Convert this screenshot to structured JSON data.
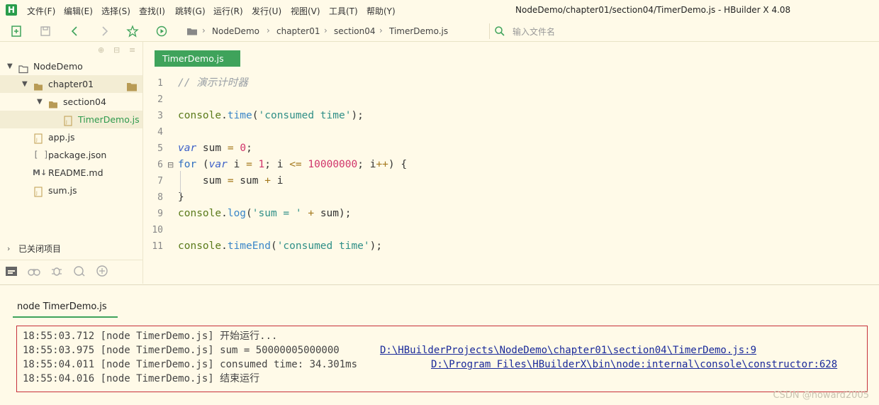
{
  "app": {
    "logo_letter": "H",
    "window_title": "NodeDemo/chapter01/section04/TimerDemo.js - HBuilder X 4.08"
  },
  "menu": [
    "文件(F)",
    "编辑(E)",
    "选择(S)",
    "查找(I)",
    "跳转(G)",
    "运行(R)",
    "发行(U)",
    "视图(V)",
    "工具(T)",
    "帮助(Y)"
  ],
  "breadcrumb": [
    "NodeDemo",
    "chapter01",
    "section04",
    "TimerDemo.js"
  ],
  "file_search": {
    "placeholder": "输入文件名"
  },
  "sidebar": {
    "tree": [
      {
        "label": "NodeDemo",
        "kind": "project",
        "depth": 0,
        "expanded": true
      },
      {
        "label": "chapter01",
        "kind": "folder",
        "depth": 1,
        "expanded": true,
        "selected": true
      },
      {
        "label": "section04",
        "kind": "folder",
        "depth": 2,
        "expanded": true
      },
      {
        "label": "TimerDemo.js",
        "kind": "js-file",
        "depth": 3,
        "active": true
      },
      {
        "label": "app.js",
        "kind": "js-file",
        "depth": 1
      },
      {
        "label": "package.json",
        "kind": "json-file",
        "depth": 1
      },
      {
        "label": "README.md",
        "kind": "md-file",
        "depth": 1
      },
      {
        "label": "sum.js",
        "kind": "js-file",
        "depth": 1
      }
    ],
    "closed_projects_label": "已关闭项目"
  },
  "editor": {
    "tab_label": "TimerDemo.js",
    "lines": [
      {
        "n": "1",
        "tokens": [
          [
            "c-comment",
            "// 演示计时器"
          ]
        ]
      },
      {
        "n": "2",
        "tokens": []
      },
      {
        "n": "3",
        "tokens": [
          [
            "c-obj",
            "console"
          ],
          [
            "c-plain",
            "."
          ],
          [
            "c-fn",
            "time"
          ],
          [
            "c-plain",
            "("
          ],
          [
            "c-str",
            "'consumed time'"
          ],
          [
            "c-plain",
            ");"
          ]
        ]
      },
      {
        "n": "4",
        "tokens": []
      },
      {
        "n": "5",
        "tokens": [
          [
            "c-kw",
            "var"
          ],
          [
            "c-plain",
            " sum "
          ],
          [
            "c-op",
            "="
          ],
          [
            "c-plain",
            " "
          ],
          [
            "c-num",
            "0"
          ],
          [
            "c-plain",
            ";"
          ]
        ]
      },
      {
        "n": "6",
        "tokens": [
          [
            "c-kw2",
            "for"
          ],
          [
            "c-plain",
            " ("
          ],
          [
            "c-kw",
            "var"
          ],
          [
            "c-plain",
            " i "
          ],
          [
            "c-op",
            "="
          ],
          [
            "c-plain",
            " "
          ],
          [
            "c-num",
            "1"
          ],
          [
            "c-plain",
            "; i "
          ],
          [
            "c-op",
            "<="
          ],
          [
            "c-plain",
            " "
          ],
          [
            "c-num",
            "10000000"
          ],
          [
            "c-plain",
            "; i"
          ],
          [
            "c-op",
            "++"
          ],
          [
            "c-plain",
            ") {"
          ]
        ]
      },
      {
        "n": "7",
        "tokens": [
          [
            "c-plain",
            "    sum "
          ],
          [
            "c-op",
            "="
          ],
          [
            "c-plain",
            " sum "
          ],
          [
            "c-op",
            "+"
          ],
          [
            "c-plain",
            " i"
          ]
        ]
      },
      {
        "n": "8",
        "tokens": [
          [
            "c-plain",
            "}"
          ]
        ]
      },
      {
        "n": "9",
        "tokens": [
          [
            "c-obj",
            "console"
          ],
          [
            "c-plain",
            "."
          ],
          [
            "c-fn",
            "log"
          ],
          [
            "c-plain",
            "("
          ],
          [
            "c-str",
            "'sum = '"
          ],
          [
            "c-plain",
            " "
          ],
          [
            "c-op",
            "+"
          ],
          [
            "c-plain",
            " sum);"
          ]
        ]
      },
      {
        "n": "10",
        "tokens": []
      },
      {
        "n": "11",
        "tokens": [
          [
            "c-obj",
            "console"
          ],
          [
            "c-plain",
            "."
          ],
          [
            "c-fn",
            "timeEnd"
          ],
          [
            "c-plain",
            "("
          ],
          [
            "c-str",
            "'consumed time'"
          ],
          [
            "c-plain",
            ");"
          ]
        ]
      }
    ]
  },
  "console": {
    "tab_label": "node TimerDemo.js",
    "lines": [
      {
        "text": "18:55:03.712 [node TimerDemo.js] 开始运行...",
        "link": ""
      },
      {
        "text": "18:55:03.975 [node TimerDemo.js] sum = 50000005000000",
        "link": "D:\\HBuilderProjects\\NodeDemo\\chapter01\\section04\\TimerDemo.js:9"
      },
      {
        "text": "18:55:04.011 [node TimerDemo.js] consumed time: 34.301ms",
        "link": "D:\\Program Files\\HBuilderX\\bin\\node:internal\\console\\constructor:628"
      },
      {
        "text": "18:55:04.016 [node TimerDemo.js] 结束运行",
        "link": ""
      }
    ]
  },
  "watermark": "CSDN @howard2005",
  "colors": {
    "accent_green": "#3fa35b",
    "console_border": "#c6303a",
    "link": "#1a2a9a"
  }
}
